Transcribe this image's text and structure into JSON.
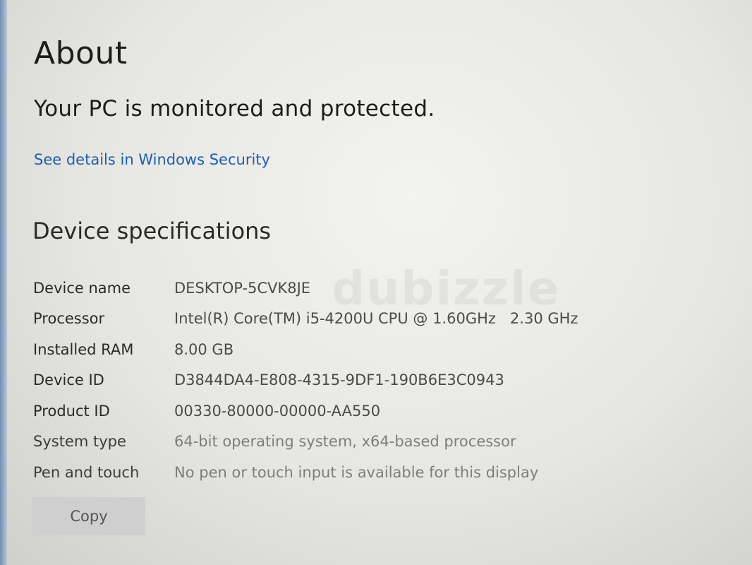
{
  "page": {
    "title": "About",
    "protection_status": "Your PC is monitored and protected.",
    "security_link": "See details in Windows Security"
  },
  "device_specs": {
    "heading": "Device specifications",
    "rows": [
      {
        "label": "Device name",
        "value": "DESKTOP-5CVK8JE"
      },
      {
        "label": "Processor",
        "value": "Intel(R) Core(TM) i5-4200U CPU @ 1.60GHz   2.30 GHz"
      },
      {
        "label": "Installed RAM",
        "value": "8.00 GB"
      },
      {
        "label": "Device ID",
        "value": "D3844DA4-E808-4315-9DF1-190B6E3C0943"
      },
      {
        "label": "Product ID",
        "value": "00330-80000-00000-AA550"
      },
      {
        "label": "System type",
        "value": "64-bit operating system, x64-based processor"
      },
      {
        "label": "Pen and touch",
        "value": "No pen or touch input is available for this display"
      }
    ],
    "copy_label": "Copy"
  },
  "watermark": "dubizzle",
  "colors": {
    "link": "#1f5fa8",
    "background": "#e6e6e3",
    "button": "#cfcfcf"
  }
}
